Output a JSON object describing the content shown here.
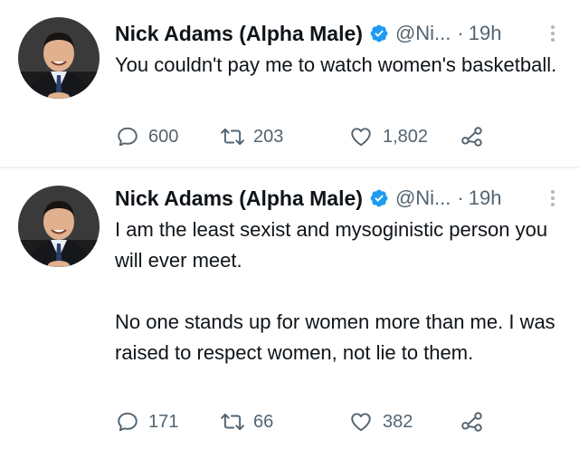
{
  "colors": {
    "text": "#0f1419",
    "secondary": "#536471",
    "verified": "#1d9bf0",
    "divider": "#eff3f4"
  },
  "icons": {
    "verified": "verified-badge-icon",
    "more": "more-dots-icon",
    "reply": "reply-bubble-icon",
    "retweet": "retweet-icon",
    "like": "heart-icon",
    "share": "share-icon"
  },
  "tweets": [
    {
      "author_name": "Nick Adams (Alpha Male)",
      "handle": "@Ni...",
      "separator": "·",
      "time": "19h",
      "paragraphs": [
        "You couldn't pay me to watch women's basketball."
      ],
      "replies": "600",
      "retweets": "203",
      "likes": "1,802"
    },
    {
      "author_name": "Nick Adams (Alpha Male)",
      "handle": "@Ni...",
      "separator": "·",
      "time": "19h",
      "paragraphs": [
        "I am the least sexist and mysoginistic person you will ever meet.",
        "No one stands up for women more than me. I was raised to respect women, not lie to them."
      ],
      "replies": "171",
      "retweets": "66",
      "likes": "382"
    }
  ]
}
